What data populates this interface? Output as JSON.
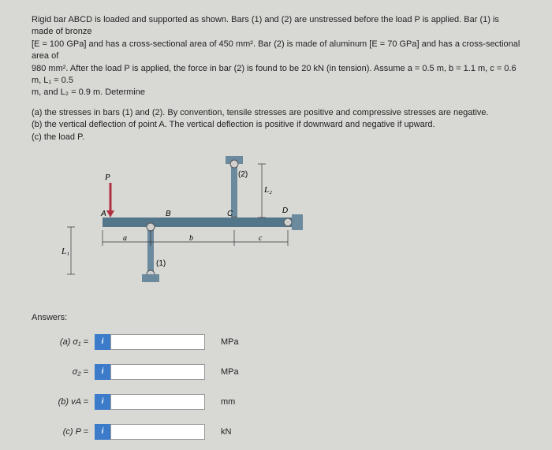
{
  "problem": {
    "line1": "Rigid bar ABCD is loaded and supported as shown. Bars (1) and (2) are unstressed before the load P is applied. Bar (1) is made of bronze",
    "line2": "[E = 100 GPa] and has a cross-sectional area of 450 mm². Bar (2) is made of aluminum [E = 70 GPa] and has a cross-sectional area of",
    "line3": "980 mm². After the load P is applied, the force in bar (2) is found to be 20 kN (in tension). Assume a = 0.5 m, b = 1.1 m, c = 0.6 m, L₁ = 0.5",
    "line4": "m, and L₂ = 0.9 m. Determine"
  },
  "subparts": {
    "a": "(a) the stresses in bars (1) and (2). By convention, tensile stresses are positive and compressive stresses are negative.",
    "b": "(b) the vertical deflection of point A. The vertical deflection is positive if downward and negative if upward.",
    "c": "(c) the load P."
  },
  "diagram": {
    "labels": {
      "P": "P",
      "A": "A",
      "B": "B",
      "C": "C",
      "D": "D",
      "L1": "L₁",
      "L2": "L₂",
      "bar1": "(1)",
      "bar2": "(2)",
      "a": "a",
      "b": "b",
      "c": "c"
    }
  },
  "answers": {
    "heading": "Answers:",
    "rows": [
      {
        "label": "(a)   σ₁ =",
        "unit": "MPa"
      },
      {
        "label": "σ₂ =",
        "unit": "MPa"
      },
      {
        "label": "(b)   vA =",
        "unit": "mm"
      },
      {
        "label": "(c)   P =",
        "unit": "kN"
      }
    ]
  },
  "icon": "i"
}
